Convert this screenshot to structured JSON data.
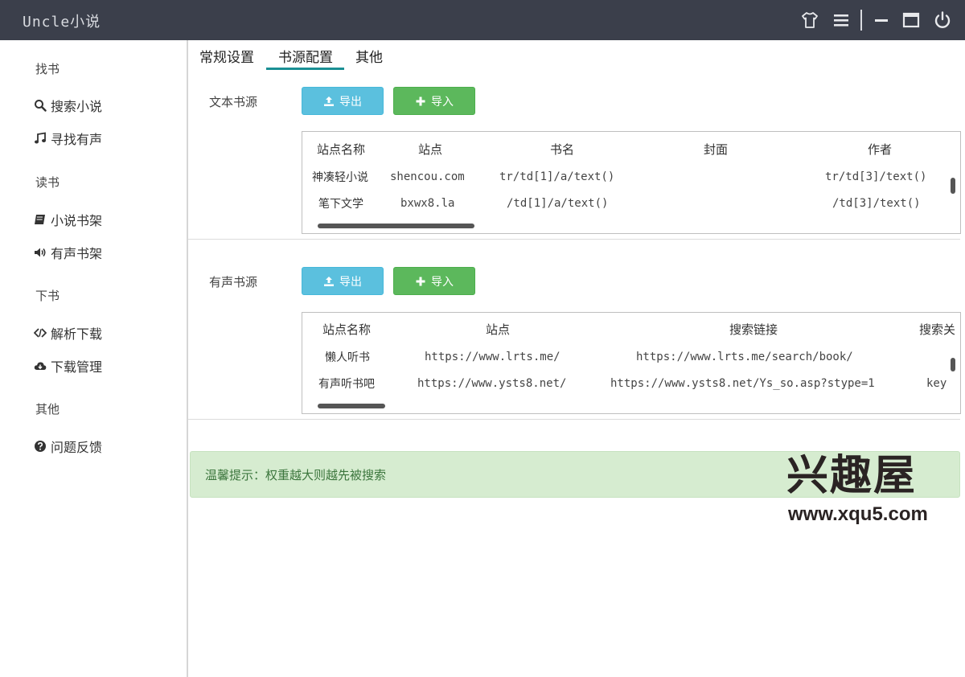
{
  "app": {
    "title": "Uncle小说"
  },
  "titlebar_icons": [
    "shirt-icon",
    "menu-icon",
    "minimize-icon",
    "maximize-icon",
    "power-icon"
  ],
  "sidebar": {
    "groups": [
      {
        "label": "找书",
        "items": [
          {
            "label": "搜索小说",
            "icon": "search-icon"
          },
          {
            "label": "寻找有声",
            "icon": "music-icon"
          }
        ]
      },
      {
        "label": "读书",
        "items": [
          {
            "label": "小说书架",
            "icon": "book-icon"
          },
          {
            "label": "有声书架",
            "icon": "volume-icon"
          }
        ]
      },
      {
        "label": "下书",
        "items": [
          {
            "label": "解析下载",
            "icon": "code-icon"
          },
          {
            "label": "下载管理",
            "icon": "cloud-download-icon"
          }
        ]
      },
      {
        "label": "其他",
        "items": [
          {
            "label": "问题反馈",
            "icon": "question-icon"
          }
        ]
      }
    ]
  },
  "tabs": [
    {
      "label": "常规设置",
      "active": false
    },
    {
      "label": "书源配置",
      "active": true
    },
    {
      "label": "其他",
      "active": false
    }
  ],
  "text_source": {
    "label": "文本书源",
    "export_label": "导出",
    "import_label": "导入",
    "columns": [
      "站点名称",
      "站点",
      "书名",
      "封面",
      "作者"
    ],
    "rows": [
      [
        "神凑轻小说",
        "shencou.com",
        "tr/td[1]/a/text()",
        "",
        "tr/td[3]/text()"
      ],
      [
        "笔下文学",
        "bxwx8.la",
        "/td[1]/a/text()",
        "",
        "/td[3]/text()"
      ]
    ]
  },
  "audio_source": {
    "label": "有声书源",
    "export_label": "导出",
    "import_label": "导入",
    "columns": [
      "站点名称",
      "站点",
      "搜索链接",
      "搜索关"
    ],
    "rows": [
      [
        "懒人听书",
        "https://www.lrts.me/",
        "https://www.lrts.me/search/book/",
        ""
      ],
      [
        "有声听书吧",
        "https://www.ysts8.net/",
        "https://www.ysts8.net/Ys_so.asp?stype=1",
        "key"
      ]
    ]
  },
  "alert": {
    "text": "温馨提示：权重越大则越先被搜索"
  },
  "watermark": {
    "title": "兴趣屋",
    "url": "www.xqu5.com"
  },
  "colors": {
    "titlebar": "#3b3f4b",
    "accent": "#1a8f94",
    "export": "#5bc0de",
    "import": "#5cb85c",
    "alert_bg": "#d6ecd0"
  }
}
